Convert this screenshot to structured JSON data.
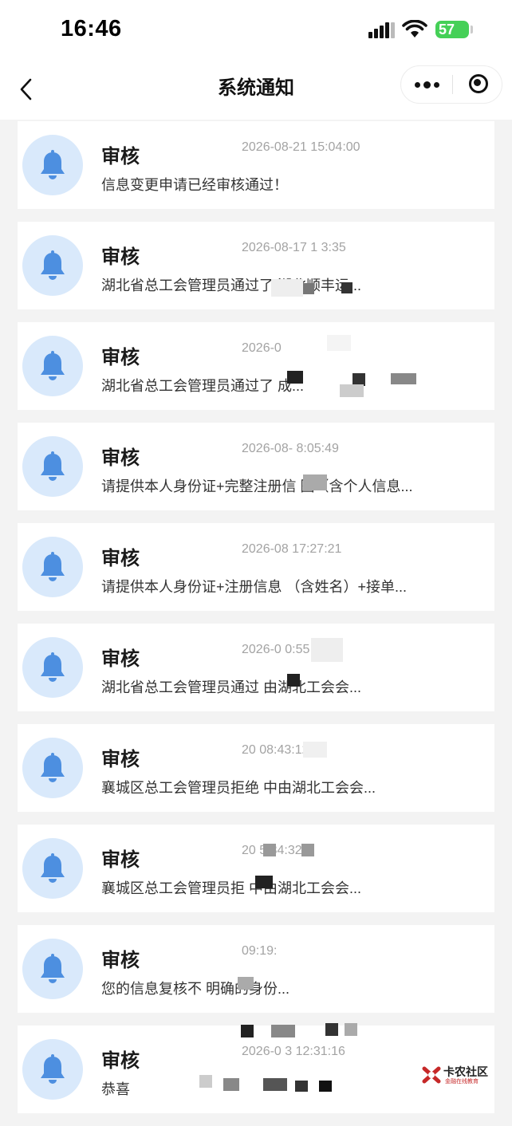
{
  "status_bar": {
    "time": "16:46",
    "battery": "57",
    "signal_icon": "cellular-signal-icon",
    "wifi_icon": "wifi-icon"
  },
  "nav": {
    "title": "系统通知",
    "back_icon": "back-chevron-icon",
    "more_icon": "more-dots-icon",
    "close_icon": "target-close-icon"
  },
  "accent_color": "#4d8fe0",
  "icon_bg_color": "#d9e9fb",
  "notifications": [
    {
      "title": "审核",
      "time": "2026-08-21 15:04:00",
      "message": "信息变更申请已经审核通过！"
    },
    {
      "title": "审核",
      "time": "2026-08-17 1  3:35",
      "message": "湖北省总工会管理员通过了              湖北顺丰运..."
    },
    {
      "title": "审核",
      "time": "2026-0",
      "message": "湖北省总工会管理员通过了                        成..."
    },
    {
      "title": "审核",
      "time": "2026-08-     8:05:49",
      "message": "请提供本人身份证+完整注册信    图（含个人信息..."
    },
    {
      "title": "审核",
      "time": "2026-08     17:27:21",
      "message": "请提供本人身份证+注册信息     （含姓名）+接单..."
    },
    {
      "title": "审核",
      "time": "2026-0          0:55",
      "message": "湖北省总工会管理员通过          由湖北工会会..."
    },
    {
      "title": "审核",
      "time": "20          08:43:12",
      "message": "襄城区总工会管理员拒绝         中由湖北工会会..."
    },
    {
      "title": "审核",
      "time": "20          5:34:32",
      "message": "襄城区总工会管理员拒          中由湖北工会会..."
    },
    {
      "title": "审核",
      "time": "               09:19:",
      "message": "您的信息复核不                    明确的身份..."
    },
    {
      "title": "审核",
      "time": "2026-0   3 12:31:16",
      "message": "恭喜"
    }
  ],
  "watermark": {
    "name": "卡农社区",
    "tagline": "金融在线教育"
  }
}
